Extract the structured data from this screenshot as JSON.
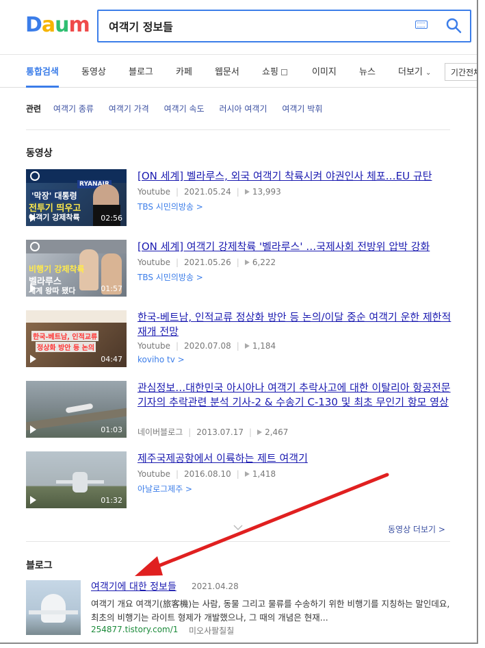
{
  "logo": {
    "letters": [
      "D",
      "a",
      "u",
      "m"
    ],
    "colors": [
      "#3b7de9",
      "#f5b400",
      "#2fbf71",
      "#ef4a4a"
    ]
  },
  "search": {
    "query": "여객기 정보들"
  },
  "tabs": [
    {
      "label": "통합검색"
    },
    {
      "label": "동영상"
    },
    {
      "label": "블로그"
    },
    {
      "label": "카페"
    },
    {
      "label": "웹문서"
    },
    {
      "label": "쇼핑"
    },
    {
      "label": "이미지"
    },
    {
      "label": "뉴스"
    },
    {
      "label": "더보기"
    }
  ],
  "period_button": "기간전체",
  "related": {
    "label": "관련",
    "items": [
      "여객기 종류",
      "여객기 가격",
      "여객기 속도",
      "러시아 여객기",
      "여객기 박휘"
    ]
  },
  "video_section": {
    "title": "동영상",
    "items": [
      {
        "title": "[ON 세계] 벨라루스, 외국 여객기 착륙시켜 야권인사 체포…EU 규탄",
        "source": "Youtube",
        "date": "2021.05.24",
        "views": "13,993",
        "channel": "TBS 시민의방송 >",
        "duration": "02:56"
      },
      {
        "title": "[ON 세계] 여객기 강제착륙 '벨라루스' …국제사회 전방위 압박 강화",
        "source": "Youtube",
        "date": "2021.05.26",
        "views": "6,222",
        "channel": "TBS 시민의방송 >",
        "duration": "01:57"
      },
      {
        "title": "한국-베트남, 인적교류 정상화 방안 등 논의/이달 중순 여객기 운한 제한적 재개 전망",
        "source": "Youtube",
        "date": "2020.07.08",
        "views": "1,184",
        "channel": "koviho tv >",
        "duration": "04:47"
      },
      {
        "title": "관심정보…대한민국 아시아나 여객기 추락사고에 대한 이탈리아 항공전문기자의 추락관련 분석 기사-2 & 수송기 C-130 및 최초 무인기 항모 영상",
        "source": "네이버블로그",
        "date": "2013.07.17",
        "views": "2,467",
        "channel": "",
        "duration": "01:03"
      },
      {
        "title": "제주국제공항에서 이륙하는 제트 여객기",
        "source": "Youtube",
        "date": "2016.08.10",
        "views": "1,418",
        "channel": "아날로그제주 >",
        "duration": "01:32"
      }
    ],
    "more": "동영상 더보기 >"
  },
  "blog_section": {
    "title": "블로그",
    "item": {
      "title": "여객기에 대한 정보들",
      "date": "2021.04.28",
      "desc": "여객기 개요 여객기(旅客機)는 사람, 동물 그리고 물류를 수송하기 위한 비행기를 지칭하는 말인데요, 최초의 비행기는 라이트 형제가 개발했으나, 그 때의 개념은 현재...",
      "url": "254877.tistory.com/1",
      "author": "미오사팔칠칠"
    }
  },
  "thumb_texts": {
    "v1": {
      "line1": "'막장' 대통령",
      "line2": "전투기 띄우고",
      "line3": "여객기 강제착륙",
      "brand": "RYANAIR"
    },
    "v2": {
      "line1": "비행기 강제착륙",
      "line2": "벨라루스",
      "line3": "세계 왕따 됐다"
    },
    "v3": {
      "line1": "한국-베트남, 인적교류",
      "line2": "정상화 방안 등 논의"
    }
  },
  "colors": {
    "accent": "#3b7de9",
    "link": "#1a1ab0",
    "arrow": "#e02020",
    "url_green": "#1b8a3a"
  }
}
